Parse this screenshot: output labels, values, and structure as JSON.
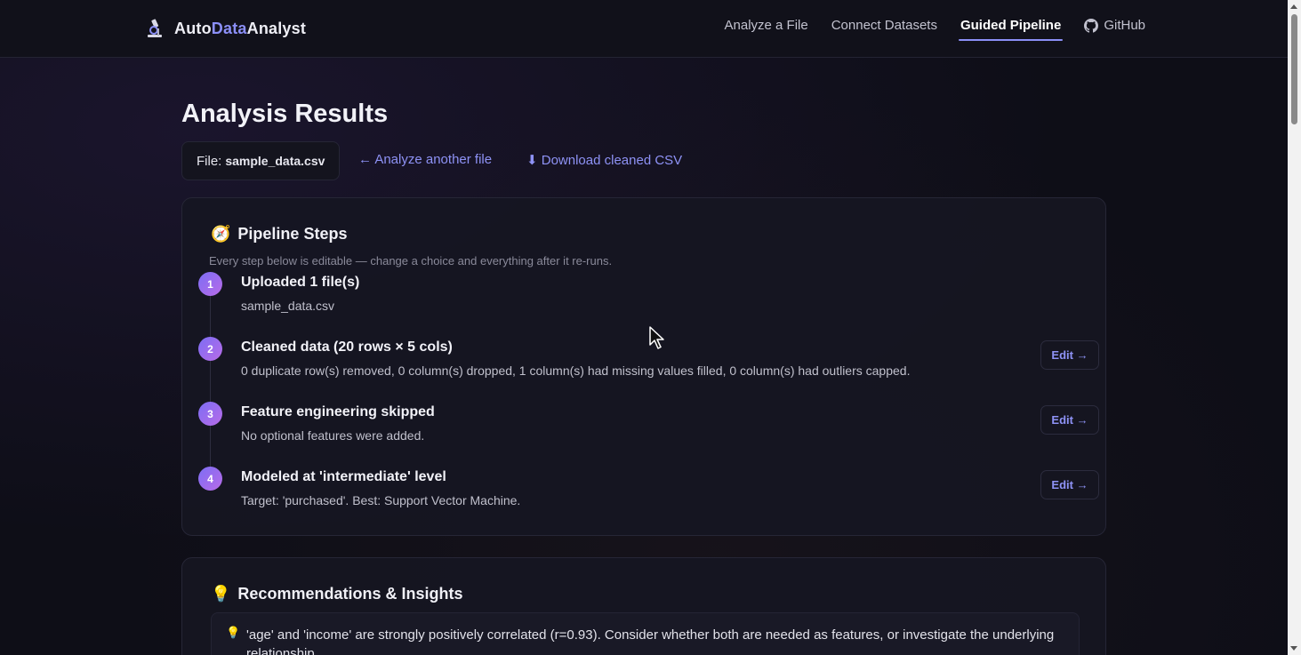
{
  "nav": {
    "brand_prefix": "Auto",
    "brand_accent": "Data",
    "brand_suffix": "Analyst",
    "brand_icon": "microscope-icon",
    "links": [
      "Analyze a File",
      "Connect Datasets",
      "Guided Pipeline",
      "GitHub"
    ],
    "active": "Guided Pipeline"
  },
  "page": {
    "title": "Analysis Results",
    "file_label": "File:",
    "file_name": "sample_data.csv",
    "analyze_another": "← Analyze another file",
    "download": "⬇ Download cleaned CSV"
  },
  "pipeline": {
    "icon": "compass-icon",
    "title": "Pipeline Steps",
    "subtitle": "Every step below is editable — change a choice and everything after it re-runs.",
    "steps": [
      {
        "num": "1",
        "title": "Uploaded 1 file(s)",
        "desc": "sample_data.csv",
        "edit": ""
      },
      {
        "num": "2",
        "title": "Cleaned data (20 rows × 5 cols)",
        "desc": "0 duplicate row(s) removed, 0 column(s) dropped, 1 column(s) had missing values filled, 0 column(s) had outliers capped.",
        "edit": "Edit →"
      },
      {
        "num": "3",
        "title": "Feature engineering skipped",
        "desc": "No optional features were added.",
        "edit": "Edit →"
      },
      {
        "num": "4",
        "title": "Modeled at 'intermediate' level",
        "desc": "Target: 'purchased'. Best: Support Vector Machine.",
        "edit": "Edit →"
      }
    ]
  },
  "insights": {
    "icon": "lightbulb-icon",
    "title": "Recommendations & Insights",
    "items": [
      {
        "text": "'age' and 'income' are strongly positively correlated (r=0.93). Consider whether both are needed as features, or investigate the underlying relationship."
      }
    ]
  },
  "colors": {
    "accent": "#8b8ff7",
    "step_gradient_start": "#7c6df4",
    "step_gradient_end": "#b86ce8"
  }
}
